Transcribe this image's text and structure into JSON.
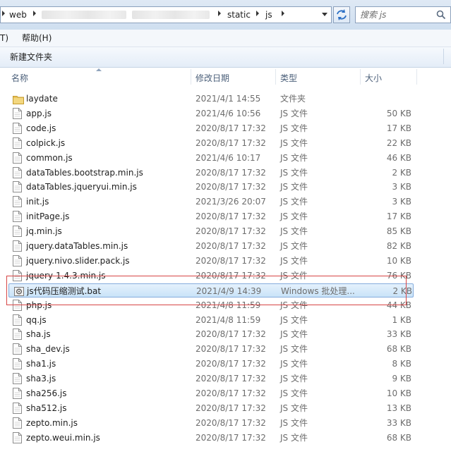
{
  "address_bar": {
    "crumbs": [
      "web",
      "static",
      "js"
    ]
  },
  "search": {
    "placeholder": "搜索 js"
  },
  "menu": {
    "items": [
      "T)",
      "帮助(H)"
    ]
  },
  "toolbar": {
    "new_folder_label": "新建文件夹"
  },
  "columns": {
    "name": "名称",
    "date": "修改日期",
    "type": "类型",
    "size": "大小"
  },
  "files": [
    {
      "name": "laydate",
      "date": "2021/4/1 14:55",
      "type": "文件夹",
      "size": "",
      "icon": "folder-icon"
    },
    {
      "name": "app.js",
      "date": "2021/4/6 10:56",
      "type": "JS 文件",
      "size": "50 KB",
      "icon": "js-file-icon"
    },
    {
      "name": "code.js",
      "date": "2020/8/17 17:32",
      "type": "JS 文件",
      "size": "17 KB",
      "icon": "js-file-icon"
    },
    {
      "name": "colpick.js",
      "date": "2020/8/17 17:32",
      "type": "JS 文件",
      "size": "22 KB",
      "icon": "js-file-icon"
    },
    {
      "name": "common.js",
      "date": "2021/4/6 10:17",
      "type": "JS 文件",
      "size": "46 KB",
      "icon": "js-file-icon"
    },
    {
      "name": "dataTables.bootstrap.min.js",
      "date": "2020/8/17 17:32",
      "type": "JS 文件",
      "size": "2 KB",
      "icon": "js-file-icon"
    },
    {
      "name": "dataTables.jqueryui.min.js",
      "date": "2020/8/17 17:32",
      "type": "JS 文件",
      "size": "3 KB",
      "icon": "js-file-icon"
    },
    {
      "name": "init.js",
      "date": "2021/3/26 20:07",
      "type": "JS 文件",
      "size": "3 KB",
      "icon": "js-file-icon"
    },
    {
      "name": "initPage.js",
      "date": "2020/8/17 17:32",
      "type": "JS 文件",
      "size": "17 KB",
      "icon": "js-file-icon"
    },
    {
      "name": "jq.min.js",
      "date": "2020/8/17 17:32",
      "type": "JS 文件",
      "size": "85 KB",
      "icon": "js-file-icon"
    },
    {
      "name": "jquery.dataTables.min.js",
      "date": "2020/8/17 17:32",
      "type": "JS 文件",
      "size": "82 KB",
      "icon": "js-file-icon"
    },
    {
      "name": "jquery.nivo.slider.pack.js",
      "date": "2020/8/17 17:32",
      "type": "JS 文件",
      "size": "10 KB",
      "icon": "js-file-icon"
    },
    {
      "name": "jquery-1.4.3.min.js",
      "date": "2020/8/17 17:32",
      "type": "JS 文件",
      "size": "76 KB",
      "icon": "js-file-icon"
    },
    {
      "name": "js代码压缩测试.bat",
      "date": "2021/4/9 14:39",
      "type": "Windows 批处理...",
      "size": "2 KB",
      "icon": "bat-file-icon",
      "selected": true
    },
    {
      "name": "php.js",
      "date": "2021/4/8 11:59",
      "type": "JS 文件",
      "size": "44 KB",
      "icon": "js-file-icon"
    },
    {
      "name": "qq.js",
      "date": "2021/4/8 11:59",
      "type": "JS 文件",
      "size": "1 KB",
      "icon": "js-file-icon"
    },
    {
      "name": "sha.js",
      "date": "2020/8/17 17:32",
      "type": "JS 文件",
      "size": "33 KB",
      "icon": "js-file-icon"
    },
    {
      "name": "sha_dev.js",
      "date": "2020/8/17 17:32",
      "type": "JS 文件",
      "size": "68 KB",
      "icon": "js-file-icon"
    },
    {
      "name": "sha1.js",
      "date": "2020/8/17 17:32",
      "type": "JS 文件",
      "size": "8 KB",
      "icon": "js-file-icon"
    },
    {
      "name": "sha3.js",
      "date": "2020/8/17 17:32",
      "type": "JS 文件",
      "size": "9 KB",
      "icon": "js-file-icon"
    },
    {
      "name": "sha256.js",
      "date": "2020/8/17 17:32",
      "type": "JS 文件",
      "size": "10 KB",
      "icon": "js-file-icon"
    },
    {
      "name": "sha512.js",
      "date": "2020/8/17 17:32",
      "type": "JS 文件",
      "size": "13 KB",
      "icon": "js-file-icon"
    },
    {
      "name": "zepto.min.js",
      "date": "2020/8/17 17:32",
      "type": "JS 文件",
      "size": "33 KB",
      "icon": "js-file-icon"
    },
    {
      "name": "zepto.weui.min.js",
      "date": "2020/8/17 17:32",
      "type": "JS 文件",
      "size": "68 KB",
      "icon": "js-file-icon"
    }
  ]
}
